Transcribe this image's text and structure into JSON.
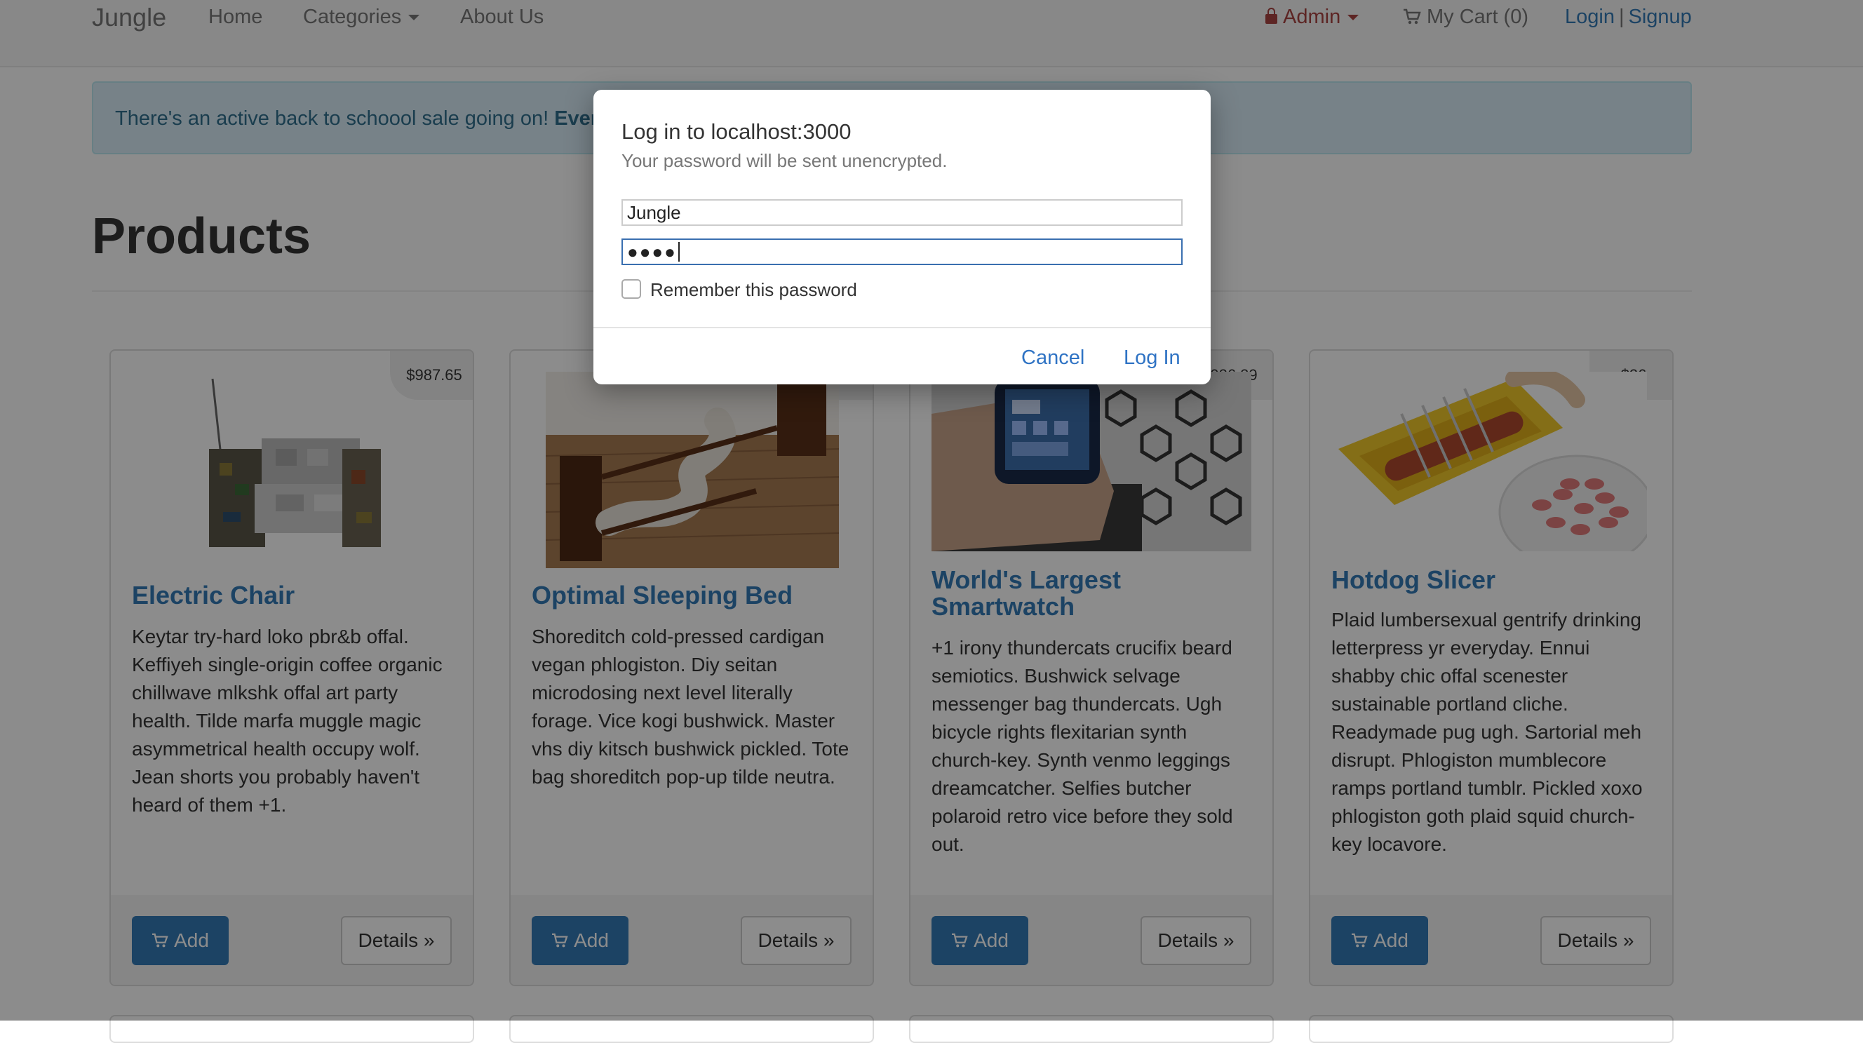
{
  "navbar": {
    "brand": "Jungle",
    "home": "Home",
    "categories": "Categories",
    "about": "About Us",
    "admin": "Admin",
    "cart": "My Cart (0)",
    "login": "Login",
    "separator": "|",
    "signup": "Signup"
  },
  "alert": {
    "text": "There's an active back to schoool sale going on! ",
    "bold": "Every"
  },
  "page": {
    "title": "Products"
  },
  "products": [
    {
      "name": "Electric Chair",
      "price": "$987.65",
      "description": "Keytar try-hard loko pbr&b offal. Keffiyeh single-origin coffee organic chillwave mlkshk offal art party health. Tilde marfa muggle magic asymmetrical health occupy wolf. Jean shorts you probably haven't heard of them +1.",
      "add_label": "Add",
      "details_label": "Details »"
    },
    {
      "name": "Optimal Sleeping Bed",
      "price": "",
      "description": "Shoreditch cold-pressed cardigan vegan phlogiston. Diy seitan microdosing next level literally forage. Vice kogi bushwick. Master vhs diy kitsch bushwick pickled. Tote bag shoreditch pop-up tilde neutra.",
      "add_label": "Add",
      "details_label": "Details »"
    },
    {
      "name": "World's Largest Smartwatch",
      "price": "026.29",
      "description": "+1 irony thundercats crucifix beard semiotics. Bushwick selvage messenger bag thundercats. Ugh bicycle rights flexitarian synth church-key. Synth venmo leggings dreamcatcher. Selfies butcher polaroid retro vice before they sold out.",
      "add_label": "Add",
      "details_label": "Details »"
    },
    {
      "name": "Hotdog Slicer",
      "price": "$26",
      "description": "Plaid lumbersexual gentrify drinking letterpress yr everyday. Ennui shabby chic offal scenester sustainable portland cliche. Readymade pug ugh. Sartorial meh disrupt. Phlogiston mumblecore ramps portland tumblr. Pickled xoxo phlogiston goth plaid squid church-key locavore.",
      "add_label": "Add",
      "details_label": "Details »"
    }
  ],
  "dialog": {
    "title": "Log in to localhost:3000",
    "subtitle": "Your password will be sent unencrypted.",
    "username_value": "Jungle",
    "password_mask": "●●●●",
    "remember_label": "Remember this password",
    "cancel": "Cancel",
    "login": "Log In"
  }
}
